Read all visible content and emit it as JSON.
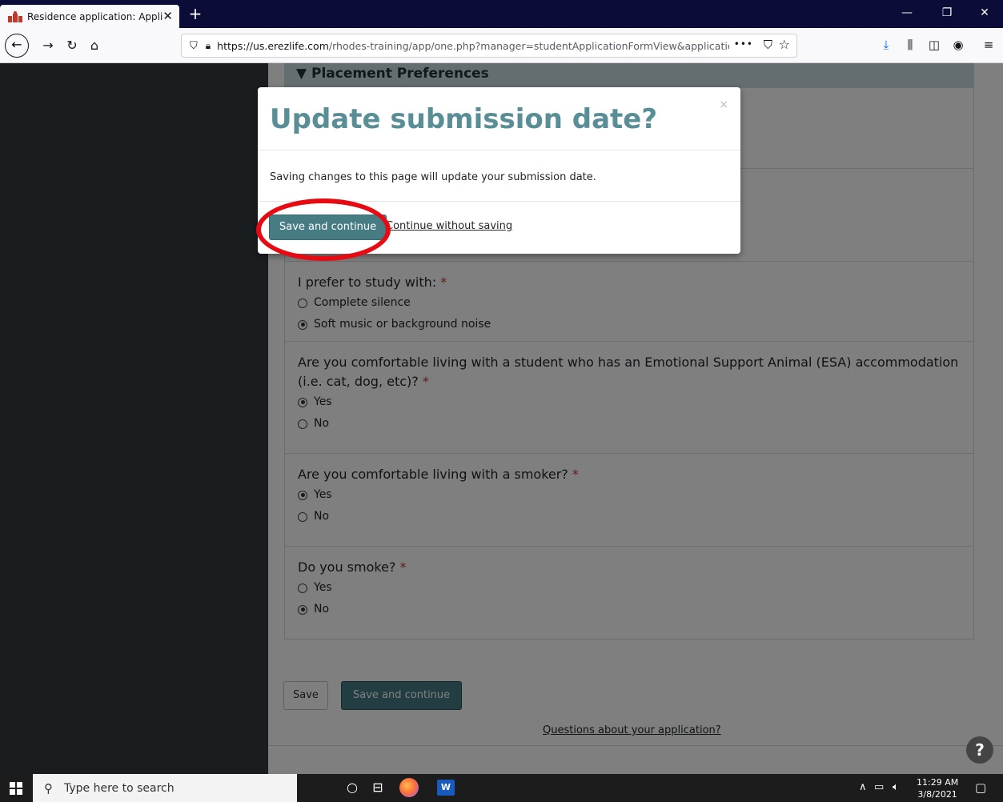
{
  "browser": {
    "tab_title": "Residence application: Applicati",
    "tab_close": "✕",
    "new_tab": "+",
    "url_host": "https://us.erezlife.com",
    "url_path": "/rhodes-training/app/one.php?manager=studentApplicationFormView&application",
    "url_more": "•••"
  },
  "page": {
    "section_header": "▼ Placement Preferences",
    "questions": [
      {
        "text": "I prefer to study with:",
        "required": "*",
        "options": [
          {
            "label": "Complete silence",
            "selected": false
          },
          {
            "label": "Soft music or background noise",
            "selected": true
          }
        ]
      },
      {
        "text": "Are you comfortable living with a student who has an Emotional Support Animal (ESA) accommodation (i.e. cat, dog, etc)?",
        "required": "*",
        "options": [
          {
            "label": "Yes",
            "selected": true
          },
          {
            "label": "No",
            "selected": false
          }
        ]
      },
      {
        "text": "Are you comfortable living with a smoker?",
        "required": "*",
        "options": [
          {
            "label": "Yes",
            "selected": true
          },
          {
            "label": "No",
            "selected": false
          }
        ]
      },
      {
        "text": "Do you smoke?",
        "required": "*",
        "options": [
          {
            "label": "Yes",
            "selected": false
          },
          {
            "label": "No",
            "selected": true
          }
        ]
      }
    ],
    "save_label": "Save",
    "save_continue_label": "Save and continue",
    "help_link": "Questions about your application?",
    "help_bubble": "?"
  },
  "modal": {
    "title": "Update submission date?",
    "close": "×",
    "body": "Saving changes to this page will update your submission date.",
    "primary_button": "Save and continue",
    "secondary_link": "Continue without saving"
  },
  "taskbar": {
    "search_placeholder": "Type here to search",
    "time": "11:29 AM",
    "date": "3/8/2021",
    "word_icon_text": "W"
  },
  "colors": {
    "accent": "#477c85",
    "modal_title": "#5a8e97",
    "annotation_circle": "#e60b12",
    "section_header_bg": "#c9dde0"
  }
}
